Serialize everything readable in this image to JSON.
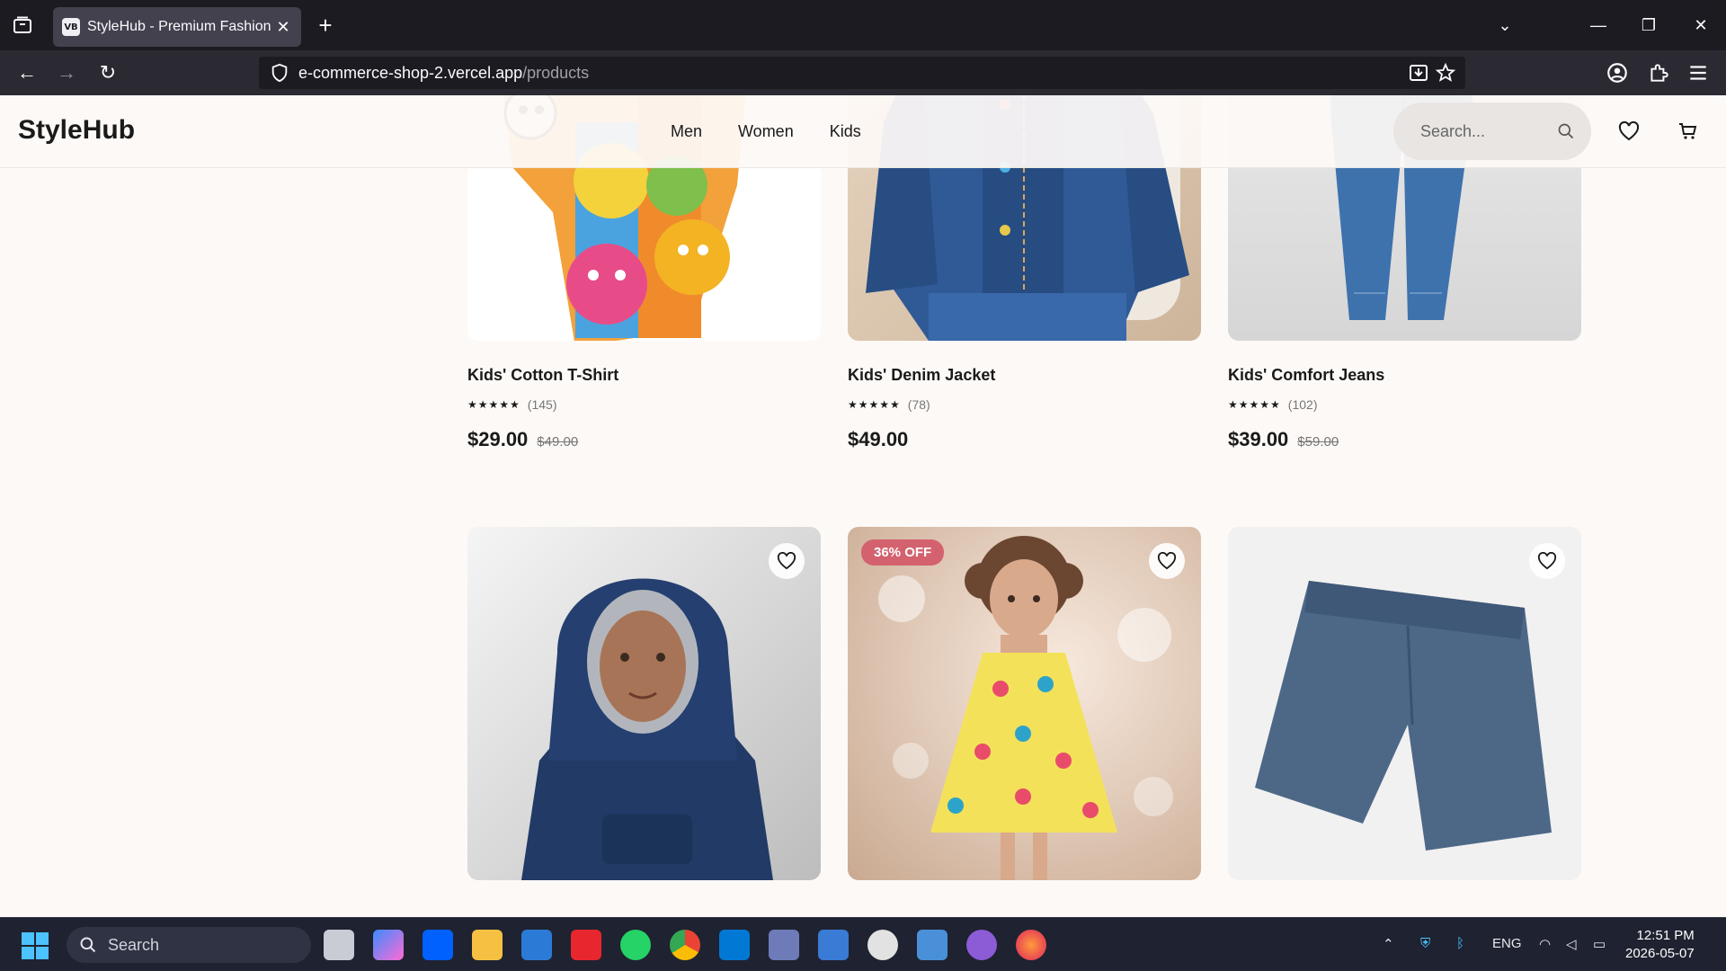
{
  "browser": {
    "tab_title": "StyleHub - Premium Fashion E-c",
    "url_host": "e-commerce-shop-2.vercel.app",
    "url_path": "/products",
    "favicon_text": "VB"
  },
  "site": {
    "logo": "StyleHub",
    "nav": [
      "Men",
      "Women",
      "Kids"
    ],
    "search_placeholder": "Search..."
  },
  "products": [
    {
      "name": "Kids' Cotton T-Shirt",
      "stars": "★★★★★",
      "reviews": "(145)",
      "price": "$29.00",
      "old_price": "$49.00",
      "badge": "",
      "image": "tshirt"
    },
    {
      "name": "Kids' Denim Jacket",
      "stars": "★★★★★",
      "reviews": "(78)",
      "price": "$49.00",
      "old_price": "",
      "badge": "",
      "image": "jacket"
    },
    {
      "name": "Kids' Comfort Jeans",
      "stars": "★★★★★",
      "reviews": "(102)",
      "price": "$39.00",
      "old_price": "$59.00",
      "badge": "",
      "image": "jeans"
    },
    {
      "name": "",
      "stars": "",
      "reviews": "",
      "price": "",
      "old_price": "",
      "badge": "",
      "image": "hoodie"
    },
    {
      "name": "",
      "stars": "",
      "reviews": "",
      "price": "",
      "old_price": "",
      "badge": "36% OFF",
      "image": "dress"
    },
    {
      "name": "",
      "stars": "",
      "reviews": "",
      "price": "",
      "old_price": "",
      "badge": "",
      "image": "shorts"
    }
  ],
  "taskbar": {
    "search_label": "Search",
    "lang": "ENG",
    "time": "12:51 PM",
    "date": "2026-05-07"
  },
  "colors": {
    "accent_badge": "#d4626e",
    "page_bg": "#fdf9f6",
    "browser_dark": "#1c1b22"
  }
}
